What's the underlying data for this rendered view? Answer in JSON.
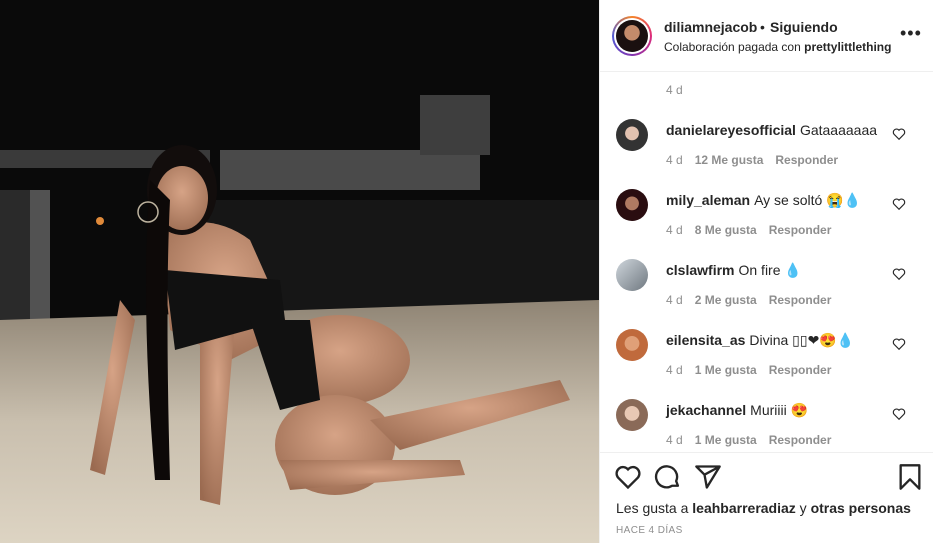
{
  "post": {
    "author": "diliamnejacob",
    "dot": "•",
    "follow_status": "Siguiendo",
    "paid_partnership_prefix": "Colaboración pagada con",
    "paid_partner": "prettylittlething",
    "more_icon": "more-horizontal-icon"
  },
  "caption_time": "4 d",
  "comments": [
    {
      "user": "danielareyesofficial",
      "text": "Gataaaaaaa",
      "time": "4 d",
      "likes": "12 Me gusta",
      "reply": "Responder"
    },
    {
      "user": "mily_aleman",
      "text": "Ay se soltó 😭💧",
      "time": "4 d",
      "likes": "8 Me gusta",
      "reply": "Responder"
    },
    {
      "user": "clslawfirm",
      "text": "On fire 💧",
      "time": "4 d",
      "likes": "2 Me gusta",
      "reply": "Responder"
    },
    {
      "user": "eilensita_as",
      "text": "Divina ▯▯❤😍💧",
      "time": "4 d",
      "likes": "1 Me gusta",
      "reply": "Responder"
    },
    {
      "user": "jekachannel",
      "text": "Muriiii 😍",
      "time": "4 d",
      "likes": "1 Me gusta",
      "reply": "Responder"
    }
  ],
  "footer": {
    "likes_prefix": "Les gusta a",
    "likes_user": "leahbarreradiaz",
    "likes_and": "y",
    "likes_others": "otras personas",
    "date": "HACE 4 DÍAS"
  },
  "colors": {
    "border": "#efefef",
    "muted": "#8e8e8e",
    "text": "#262626"
  }
}
